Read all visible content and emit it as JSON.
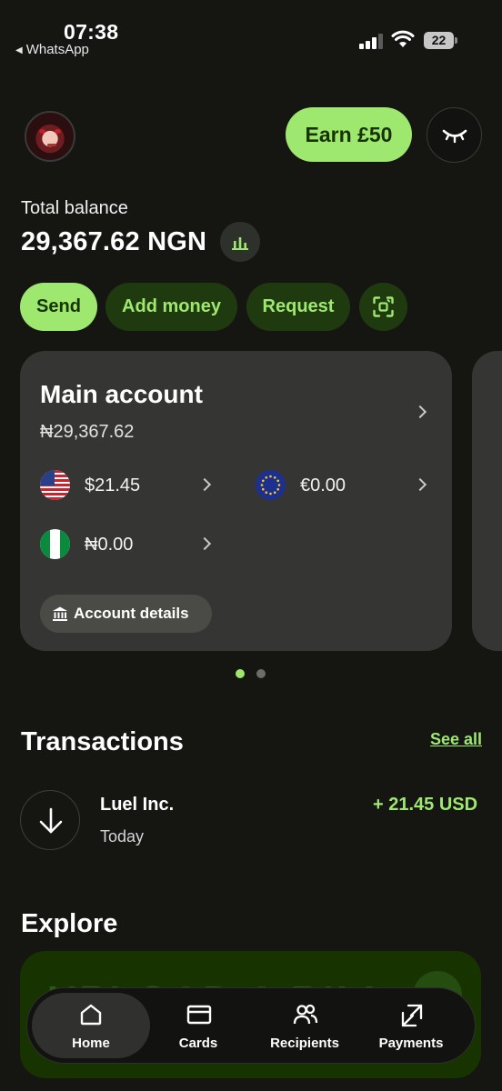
{
  "status_bar": {
    "time": "07:38",
    "back_app": "WhatsApp",
    "battery": "22"
  },
  "header": {
    "earn_label": "Earn £50",
    "avatar_icon": "profile-avatar",
    "eye_icon": "closed-eye-icon"
  },
  "balance": {
    "label": "Total balance",
    "value": "29,367.62 NGN"
  },
  "actions": {
    "send": "Send",
    "add_money": "Add money",
    "request": "Request",
    "scan_icon": "scan-icon"
  },
  "account_card": {
    "title": "Main account",
    "balance": "₦29,367.62",
    "currencies": [
      {
        "code": "USD",
        "amount": "$21.45",
        "flag": "us-flag"
      },
      {
        "code": "EUR",
        "amount": "€0.00",
        "flag": "eu-flag"
      },
      {
        "code": "NGN",
        "amount": "₦0.00",
        "flag": "ng-flag"
      }
    ],
    "details_label": "Account details"
  },
  "pagination": {
    "pages": 2,
    "active": 1
  },
  "transactions": {
    "heading": "Transactions",
    "see_all": "See all",
    "items": [
      {
        "name": "Luel Inc.",
        "date": "Today",
        "amount": "+ 21.45 USD",
        "icon": "arrow-down-icon"
      }
    ]
  },
  "explore": {
    "heading": "Explore",
    "banner_text": "UPLOAD A BILL"
  },
  "nav": {
    "items": [
      {
        "label": "Home",
        "icon": "home-icon",
        "active": true
      },
      {
        "label": "Cards",
        "icon": "card-icon",
        "active": false
      },
      {
        "label": "Recipients",
        "icon": "recipients-icon",
        "active": false
      },
      {
        "label": "Payments",
        "icon": "payments-icon",
        "active": false
      }
    ]
  },
  "colors": {
    "background": "#151612",
    "accent": "#9fe870",
    "accent_dark": "#163300",
    "card": "#353633"
  }
}
